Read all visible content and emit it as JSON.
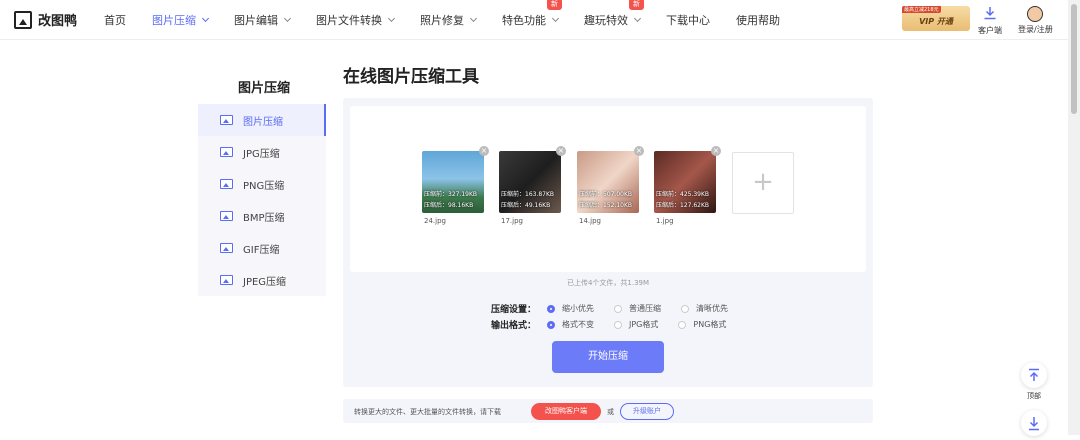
{
  "logo": {
    "text": "改图鸭"
  },
  "nav": [
    {
      "label": "首页",
      "dropdown": false,
      "active": false
    },
    {
      "label": "图片压缩",
      "dropdown": true,
      "active": true
    },
    {
      "label": "图片编辑",
      "dropdown": true,
      "active": false
    },
    {
      "label": "图片文件转换",
      "dropdown": true,
      "active": false
    },
    {
      "label": "照片修复",
      "dropdown": true,
      "active": false
    },
    {
      "label": "特色功能",
      "dropdown": true,
      "active": false,
      "badge": "新"
    },
    {
      "label": "趣玩特效",
      "dropdown": true,
      "active": false,
      "badge": "新"
    },
    {
      "label": "下载中心",
      "dropdown": false,
      "active": false
    },
    {
      "label": "使用帮助",
      "dropdown": false,
      "active": false
    }
  ],
  "vip": {
    "top": "最高立减218元",
    "label": "VIP 开通"
  },
  "header_actions": {
    "client": "客户端",
    "login": "登录/注册"
  },
  "sidebar": {
    "title": "图片压缩",
    "items": [
      {
        "label": "图片压缩",
        "tag": "",
        "active": true
      },
      {
        "label": "JPG压缩",
        "tag": "JPG",
        "active": false
      },
      {
        "label": "PNG压缩",
        "tag": "PNG",
        "active": false
      },
      {
        "label": "BMP压缩",
        "tag": "BMP",
        "active": false
      },
      {
        "label": "GIF压缩",
        "tag": "GIF",
        "active": false
      },
      {
        "label": "JPEG压缩",
        "tag": "JPEG",
        "active": false
      }
    ]
  },
  "main": {
    "title": "在线图片压缩工具",
    "files": [
      {
        "name": "24.jpg",
        "before": "压缩前：327.19KB",
        "after": "压缩后：98.16KB"
      },
      {
        "name": "17.jpg",
        "before": "压缩前：163.87KB",
        "after": "压缩后：49.16KB"
      },
      {
        "name": "14.jpg",
        "before": "压缩前：507.00KB",
        "after": "压缩后：152.10KB"
      },
      {
        "name": "1.jpg",
        "before": "压缩前：425.39KB",
        "after": "压缩后：127.62KB"
      }
    ],
    "summary": "已上传4个文件，共1.39M",
    "settings_label": "压缩设置：",
    "settings_options": [
      {
        "label": "缩小优先",
        "checked": true
      },
      {
        "label": "普通压缩",
        "checked": false
      },
      {
        "label": "清晰优先",
        "checked": false
      }
    ],
    "format_label": "输出格式：",
    "format_options": [
      {
        "label": "格式不变",
        "checked": true
      },
      {
        "label": "JPG格式",
        "checked": false
      },
      {
        "label": "PNG格式",
        "checked": false
      }
    ],
    "start_button": "开始压缩"
  },
  "bottom_bar": {
    "text": "转换更大的文件、更大批量的文件转换，请下载",
    "client_button": "改图鸭客户端",
    "or": "或",
    "upgrade_button": "升级账户"
  },
  "float": {
    "top_label": "顶部"
  },
  "colors": {
    "accent": "#5b6cf5",
    "badge": "#f4524d",
    "vip_gold": "#e9bd73"
  }
}
